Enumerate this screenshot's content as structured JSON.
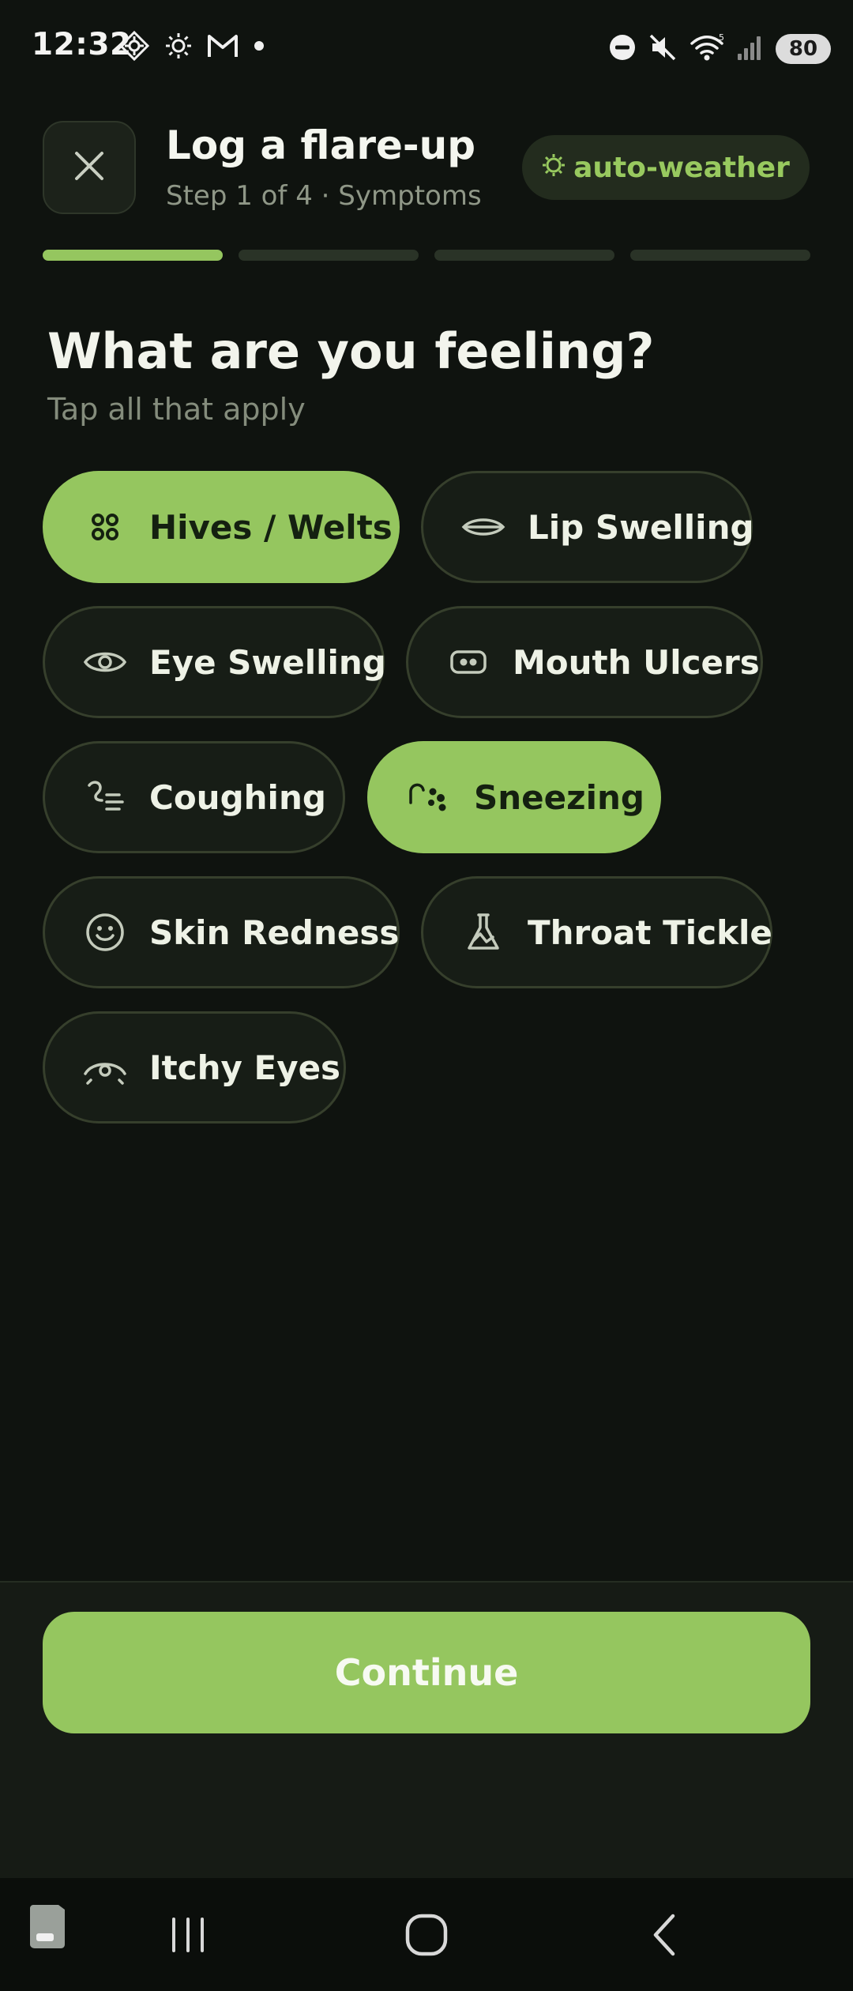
{
  "status_bar": {
    "time": "12:32",
    "battery": "80",
    "left_icons": [
      "crosshair-diamond-icon",
      "brightness-icon",
      "gmail-icon",
      "dot-icon"
    ],
    "right_icons": [
      "do-not-disturb-icon",
      "mute-icon",
      "wifi-icon",
      "signal-icon",
      "battery-icon"
    ]
  },
  "header": {
    "title": "Log a flare-up",
    "subtitle": "Step 1 of 4 · Symptoms",
    "weather_badge": "auto-weather",
    "close_icon": "close-icon"
  },
  "progress": {
    "total_steps": 4,
    "current_step": 1
  },
  "question": {
    "title": "What are you feeling?",
    "hint": "Tap all that apply"
  },
  "symptoms": [
    {
      "label": "Hives / Welts",
      "icon": "hives-icon",
      "selected": true
    },
    {
      "label": "Lip Swelling",
      "icon": "lips-icon",
      "selected": false
    },
    {
      "label": "Eye Swelling",
      "icon": "eye-icon",
      "selected": false
    },
    {
      "label": "Mouth Ulcers",
      "icon": "mouth-icon",
      "selected": false
    },
    {
      "label": "Coughing",
      "icon": "cough-icon",
      "selected": false
    },
    {
      "label": "Sneezing",
      "icon": "sneeze-icon",
      "selected": true
    },
    {
      "label": "Skin Redness",
      "icon": "smiley-icon",
      "selected": false
    },
    {
      "label": "Throat Tickle",
      "icon": "flask-icon",
      "selected": false
    },
    {
      "label": "Itchy Eyes",
      "icon": "itchy-eye-icon",
      "selected": false
    }
  ],
  "footer": {
    "continue_label": "Continue"
  },
  "colors": {
    "background": "#0f130f",
    "accent": "#95c65f",
    "chip_background": "#171d16",
    "chip_border": "#363f2c",
    "muted_text": "#848c7c"
  },
  "nav_bar": {
    "items": [
      "app-switcher-icon",
      "recents-icon",
      "home-icon",
      "back-icon"
    ]
  }
}
